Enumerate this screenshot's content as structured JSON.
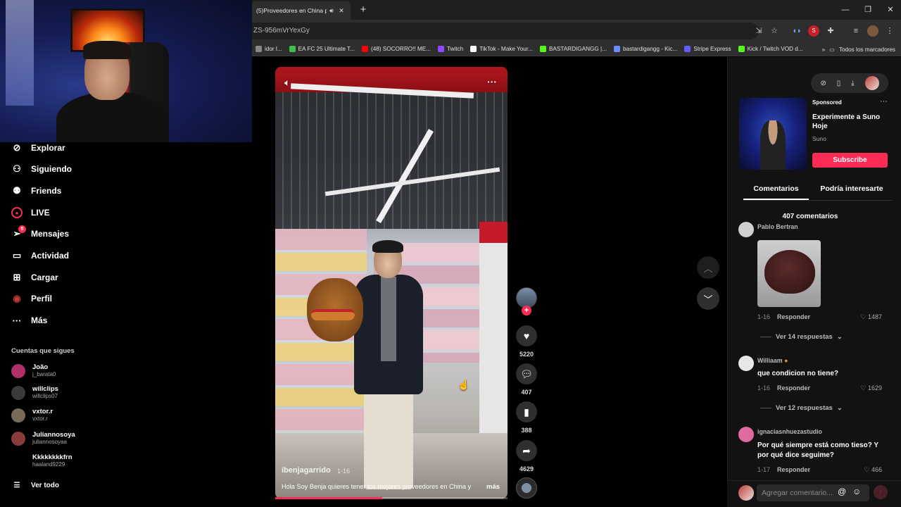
{
  "browser": {
    "tab_title": "(5)Proveedores en China pa",
    "url": "ZS-956mVrYexGy",
    "bookmarks": [
      {
        "label": "idor l...",
        "color": "#888888"
      },
      {
        "label": "EA FC 25 Ultimate T...",
        "color": "#3fbf4a"
      },
      {
        "label": "(48) SOCORRO!! ME...",
        "color": "#ff0000"
      },
      {
        "label": "Twitch",
        "color": "#9146ff"
      },
      {
        "label": "TikTok - Make Your...",
        "color": "#ffffff"
      },
      {
        "label": "BASTARDIGANGG |...",
        "color": "#53fc18"
      },
      {
        "label": "bastardigangg - Kic...",
        "color": "#6c8cff"
      },
      {
        "label": "Stripe Express",
        "color": "#635bff"
      },
      {
        "label": "Kick / Twitch VOD d...",
        "color": "#53fc18"
      }
    ],
    "all_bookmarks": "Todos los marcadores"
  },
  "sidebar": {
    "nav": [
      {
        "label": "Explorar",
        "icon": "compass-icon",
        "glyph": "⊘"
      },
      {
        "label": "Siguiendo",
        "icon": "person-follow-icon",
        "glyph": "⚇"
      },
      {
        "label": "Friends",
        "icon": "friends-icon",
        "glyph": "⚉"
      },
      {
        "label": "LIVE",
        "icon": "live-icon",
        "glyph": "●"
      },
      {
        "label": "Mensajes",
        "icon": "send-icon",
        "glyph": "➢"
      },
      {
        "label": "Actividad",
        "icon": "activity-icon",
        "glyph": "▭"
      },
      {
        "label": "Cargar",
        "icon": "upload-icon",
        "glyph": "⊞"
      },
      {
        "label": "Perfil",
        "icon": "profile-avatar-icon",
        "glyph": "◉"
      },
      {
        "label": "Más",
        "icon": "more-icon",
        "glyph": "···"
      }
    ],
    "messages_badge": "5",
    "following_title": "Cuentas que sigues",
    "following": [
      {
        "name": "João",
        "handle": "j_barata0",
        "color": "#b0306a"
      },
      {
        "name": "willclips",
        "handle": "willclips07",
        "color": "#3a3a3a"
      },
      {
        "name": "vxtor.r",
        "handle": "vxtor.r",
        "color": "#7a6a5a"
      },
      {
        "name": "Juliannosoya",
        "handle": "juliannosoyaa",
        "color": "#8a3b3b"
      },
      {
        "name": "Kkkkkkkkfrn",
        "handle": "haaland9229",
        "color": "#000000"
      }
    ],
    "see_all": "Ver todo"
  },
  "video": {
    "author": "ibenjagarrido",
    "date": "1-16",
    "description": "Hola Soy Benja quieres tener los mejores proveedores en China y",
    "more": "más",
    "progress": 0.46
  },
  "actions": {
    "likes": "5220",
    "comments": "407",
    "saves": "388",
    "shares": "4629"
  },
  "ad": {
    "sponsored": "Sponsored",
    "title": "Experimente a Suno Hoje",
    "brand": "Suno",
    "button": "Subscribe"
  },
  "panel": {
    "tab_comments": "Comentarios",
    "tab_interest": "Podría interesarte",
    "comment_count": "407 comentarios"
  },
  "comments": [
    {
      "user": "Pablo Bertran",
      "text": "",
      "date": "1-16",
      "reply": "Responder",
      "likes": "1487",
      "view_replies": "Ver 14 respuestas",
      "avatar_color": "#d0d0d0"
    },
    {
      "user": "Williaam",
      "text": "que condicion no tiene?",
      "date": "1-16",
      "reply": "Responder",
      "likes": "1629",
      "view_replies": "Ver 12 respuestas",
      "avatar_color": "#e8e8e8"
    },
    {
      "user": "ignaciasnhuezastudio",
      "text": "Por qué siempre está como tieso? Y por qué dice seguime?",
      "date": "1-17",
      "reply": "Responder",
      "likes": "466",
      "view_replies": "",
      "avatar_color": "#e06aa0"
    }
  ],
  "comment_input": {
    "placeholder": "Agregar comentario..."
  }
}
